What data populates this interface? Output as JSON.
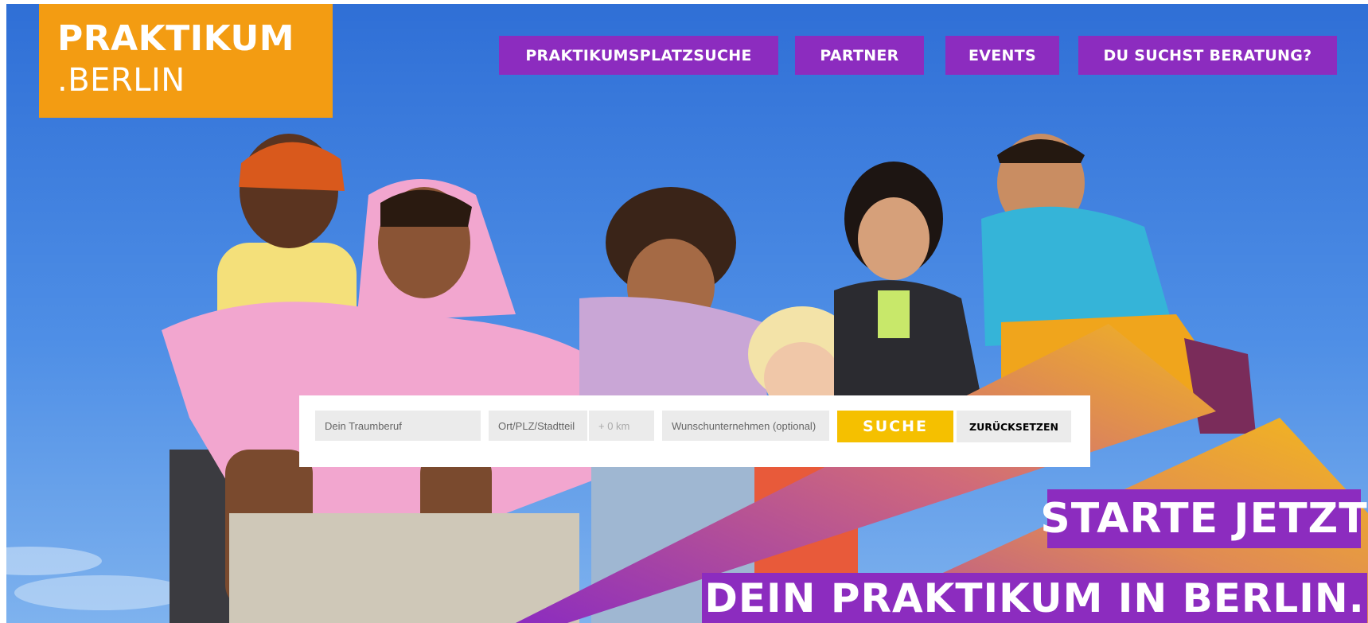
{
  "logo": {
    "line1": "PRAKTIKUM",
    "line2": ".BERLIN"
  },
  "nav": {
    "items": [
      {
        "label": "PRAKTIKUMSPLATZSUCHE"
      },
      {
        "label": "PARTNER"
      },
      {
        "label": "EVENTS"
      },
      {
        "label": "DU SUCHST BERATUNG?"
      }
    ]
  },
  "search": {
    "job_placeholder": "Dein Traumberuf",
    "location_placeholder": "Ort/PLZ/Stadtteil",
    "radius_value": "+ 0 km",
    "company_placeholder": "Wunschunternehmen (optional)",
    "submit_label": "SUCHE",
    "reset_label": "ZURÜCKSETZEN"
  },
  "hero": {
    "headline_1": "STARTE JETZT",
    "headline_2": "DEIN PRAKTIKUM IN BERLIN."
  },
  "colors": {
    "brand_orange": "#f39c12",
    "brand_purple": "#8c2cbf",
    "search_yellow": "#f5c000",
    "sky_blue": "#3a7ee0"
  }
}
